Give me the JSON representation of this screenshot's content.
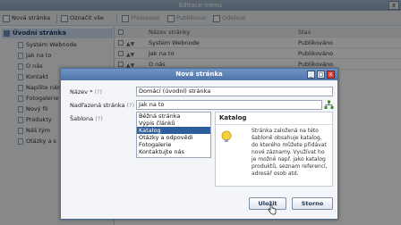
{
  "bg": {
    "title": "Editace menu",
    "close_label": "x",
    "toolbar": {
      "new_page": "Nová stránka",
      "select_all": "Označit vše",
      "move": "Přesunout",
      "publish": "Publikovat",
      "delete": "Odebrat"
    },
    "tree": {
      "root": "Úvodní stránka",
      "items": [
        "Systém Webnode",
        "Jak na to",
        "O nás",
        "Kontakt",
        "Napište nám",
        "Fotogalerie",
        "Nový fil",
        "Produkty",
        "Náš tým",
        "Otázky a s"
      ]
    },
    "table": {
      "col_name": "Název stránky",
      "col_status": "Stav",
      "rows": [
        {
          "name": "Systém Webnode",
          "status": "Publikováno"
        },
        {
          "name": "Jak na to",
          "status": "Publikováno"
        },
        {
          "name": "O nás",
          "status": "Publikováno"
        }
      ]
    }
  },
  "modal": {
    "title": "Nová stránka",
    "name_label": "Název",
    "name_value": "Domácí (úvodní) stránka",
    "parent_label": "Nadřazená stránka",
    "parent_value": "Jak na to",
    "template_label": "Šablona",
    "req_marker": "*",
    "help_marker": "(?)",
    "templates": [
      "Běžná stránka",
      "Výpis článků",
      "Katalog",
      "Otázky a odpovědi",
      "Fotogalerie",
      "Kontaktujte nás"
    ],
    "selected_template_index": 2,
    "desc_title": "Katalog",
    "desc_text": "Stránka založená na této šabloně obsahuje katalog, do kterého můžete přidávat nové záznamy. Využívat ho je možné např. jako katalog produktů, seznam referencí, adresář osob atd.",
    "save_label": "Uložit",
    "cancel_label": "Storno"
  },
  "colors": {
    "accent": "#4f75a8",
    "selected": "#2f5e9e",
    "close": "#d9443a"
  }
}
